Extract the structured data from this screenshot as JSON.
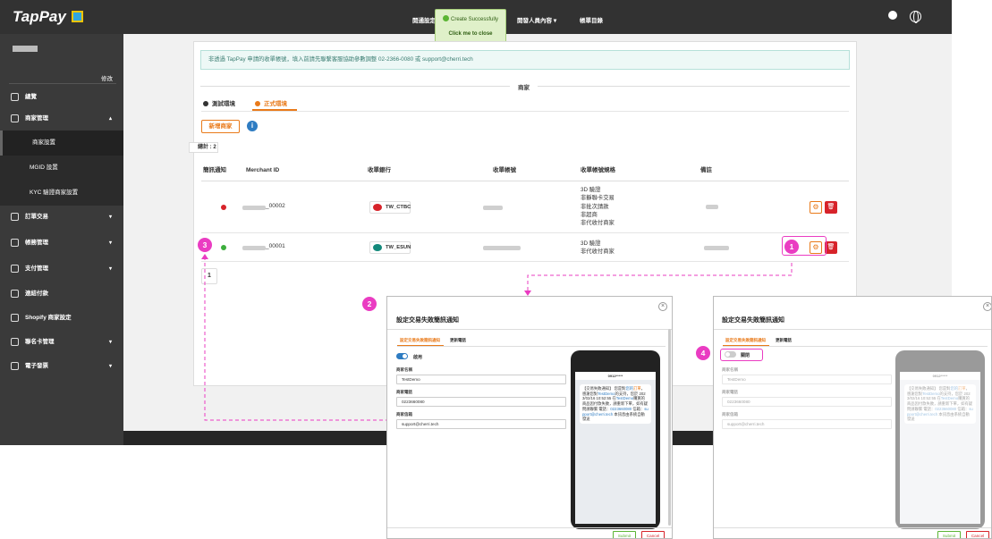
{
  "app": {
    "logo": "TapPay"
  },
  "topnav": {
    "items": [
      "開通設定",
      "開發人員內容",
      "帳單目錄"
    ],
    "arrow": "▾"
  },
  "toast": {
    "message": "Create Successfully",
    "close": "Click me to close"
  },
  "sidebar": {
    "edit": "修改",
    "items": [
      {
        "label": "總覽",
        "icon": "dashboard-icon"
      },
      {
        "label": "商家管理",
        "icon": "store-icon",
        "chevron": "▴"
      },
      {
        "label": "訂單交易",
        "icon": "order-icon",
        "chevron": "▾"
      },
      {
        "label": "帳務管理",
        "icon": "bank-icon",
        "chevron": "▾"
      },
      {
        "label": "支付管理",
        "icon": "payment-icon",
        "chevron": "▾"
      },
      {
        "label": "連結付款",
        "icon": "link-icon"
      },
      {
        "label": "Shopify 商家設定",
        "icon": "shopify-icon"
      },
      {
        "label": "聯名卡管理",
        "icon": "card-icon",
        "chevron": "▾"
      },
      {
        "label": "電子發票",
        "icon": "invoice-icon",
        "chevron": "▾"
      }
    ],
    "subitems": [
      "商家設置",
      "MGID 設置",
      "KYC 驗證商家設置"
    ]
  },
  "main": {
    "notice": "非透過 TapPay 申請的收單帳號，填入前請先聯繫客服協助參數調整 02-2366-0080 或 support@cherri.tech",
    "section_title": "商家",
    "tabs": [
      "測試環境",
      "正式環境"
    ],
    "add_button": "新增商家",
    "info_icon": "i",
    "total": "總計 : 2",
    "columns": [
      "簡訊通知",
      "Merchant ID",
      "收單銀行",
      "收單帳號",
      "收單帳號規格",
      "備註"
    ],
    "rows": [
      {
        "status_color": "#d7232a",
        "merchant_suffix": "_00002",
        "bank": "TW_CTBC",
        "bank_color": "#d7232a",
        "specs": [
          "3D 驗證",
          "非靜聯卡交易",
          "非批次請款",
          "非超商",
          "非代收付商家"
        ]
      },
      {
        "status_color": "#3cae3c",
        "merchant_suffix": "_00001",
        "bank": "TW_ESUN",
        "bank_color": "#13897b",
        "specs": [
          "3D 驗證",
          "非代收付商家"
        ]
      }
    ],
    "page": "1",
    "action_icons": {
      "edit": "⚙",
      "delete": "🗑"
    }
  },
  "badges": [
    "1",
    "2",
    "3",
    "4"
  ],
  "modal": {
    "title": "設定交易失敗簡訊通知",
    "close": "×",
    "tabs": [
      "設定交易失敗簡訊通知",
      "更新電話"
    ],
    "toggle_on_label": "啟用",
    "toggle_off_label": "關閉",
    "fields": [
      {
        "label": "商家名稱",
        "value": "TestDemo"
      },
      {
        "label": "商家電話",
        "value": "0223660080"
      },
      {
        "label": "商家信箱",
        "value": "support@cherri.tech"
      }
    ],
    "phone": {
      "header": "0912*****",
      "sms_parts": [
        "【交易失敗通知】 您是對",
        "您的",
        "訂單",
        "，感謝您對",
        "TestDemo",
        "的支持，您於 2023/02/16 10:52:55 在",
        "TestDemo",
        "購買的商品因付款失敗，請重新下單，如有疑問請聯繫 電話：",
        "0223660080",
        " 信箱：",
        "support@cherri.tech",
        " 本訊息由系統自動發送"
      ]
    },
    "submit": "Submit",
    "cancel": "Cancel"
  }
}
